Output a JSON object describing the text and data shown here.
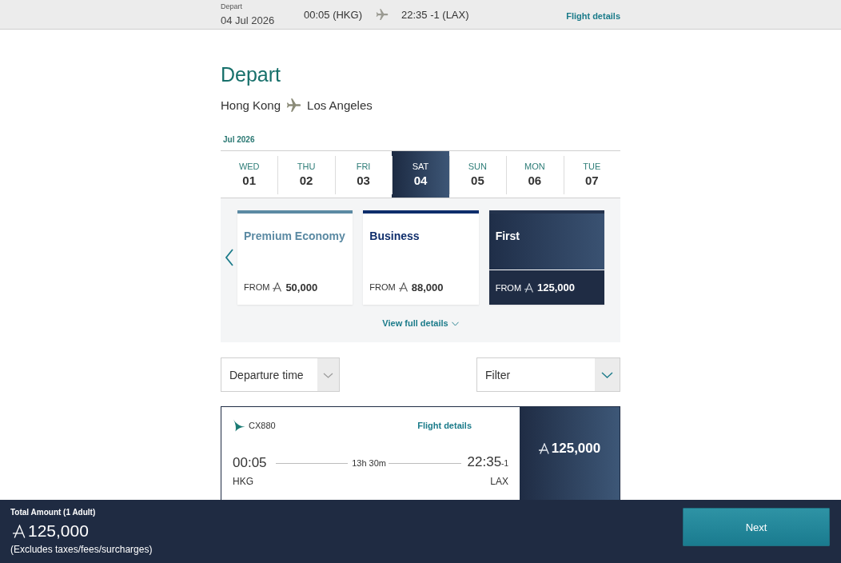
{
  "summary_bar": {
    "label": "Depart",
    "date": "04 Jul 2026",
    "departure": "00:05 (HKG)",
    "arrival": "22:35 -1 (LAX)",
    "link": "Flight details"
  },
  "heading": "Depart",
  "route": {
    "origin": "Hong Kong",
    "destination": "Los Angeles"
  },
  "date_strip": {
    "month": "Jul 2026",
    "days": [
      {
        "weekday": "WED",
        "day": "01",
        "selected": false
      },
      {
        "weekday": "THU",
        "day": "02",
        "selected": false
      },
      {
        "weekday": "FRI",
        "day": "03",
        "selected": false
      },
      {
        "weekday": "SAT",
        "day": "04",
        "selected": true
      },
      {
        "weekday": "SUN",
        "day": "05",
        "selected": false
      },
      {
        "weekday": "MON",
        "day": "06",
        "selected": false
      },
      {
        "weekday": "TUE",
        "day": "07",
        "selected": false
      }
    ]
  },
  "cabins": {
    "items": [
      {
        "name": "Premium Economy",
        "price_label": "FROM",
        "price": "50,000",
        "color": "#5b8aa3",
        "selected": false
      },
      {
        "name": "Business",
        "price_label": "FROM",
        "price": "88,000",
        "color": "#0e2d6b",
        "selected": false
      },
      {
        "name": "First",
        "price_label": "FROM",
        "price": "125,000",
        "color": "#24334d",
        "selected": true
      }
    ],
    "link": "View full details"
  },
  "sort": {
    "value": "Departure time"
  },
  "filter": {
    "value": "Filter"
  },
  "flights": [
    {
      "number": "CX880",
      "link": "Flight details",
      "depart_time": "00:05",
      "depart_airport": "HKG",
      "duration": "13h 30m",
      "arrive_time": "22:35$_{-1}$",
      "arrive_airport": "LAX",
      "price": "125,000"
    }
  ],
  "footer": {
    "label": "Total Amount (1 Adult)",
    "total": "125,000",
    "note": "(Excludes taxes/fees/surcharges)",
    "button": "Next"
  }
}
